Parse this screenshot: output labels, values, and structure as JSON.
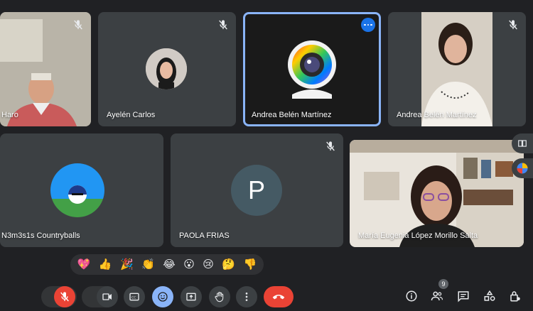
{
  "participants": [
    {
      "name": "Haro"
    },
    {
      "name": "Ayelén Carlos"
    },
    {
      "name": "Andrea Belén Martínez"
    },
    {
      "name": "Andrea Belén Martínez"
    },
    {
      "name": "N3m3s1s Countryballs"
    },
    {
      "name": "PAOLA FRIAS",
      "initial": "P"
    },
    {
      "name": "María Eugenia López Morillo Salta"
    }
  ],
  "reactions": [
    "💖",
    "👍",
    "🎉",
    "👏",
    "😂",
    "😮",
    "😢",
    "🤔",
    "👎"
  ],
  "people_count": "9",
  "colors": {
    "background": "#202124",
    "tile": "#3c4043",
    "active_border": "#8ab4f8",
    "end_call": "#ea4335",
    "avatar_p": "#455a64"
  }
}
